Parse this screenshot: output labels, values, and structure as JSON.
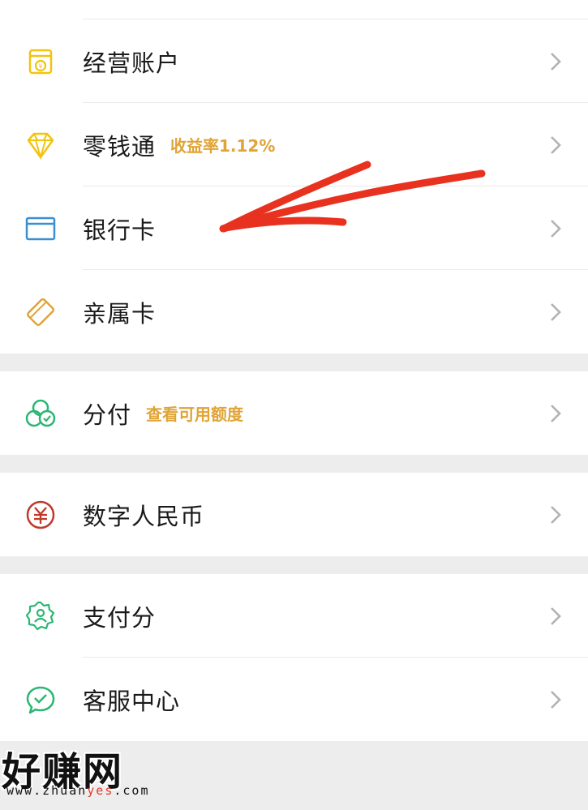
{
  "menu": {
    "group1": [
      {
        "label": "经营账户",
        "icon": "shop-account-icon",
        "color": "#f1c40f"
      },
      {
        "label": "零钱通",
        "tag": "收益率1.12%",
        "icon": "diamond-icon",
        "color": "#f1c40f"
      },
      {
        "label": "银行卡",
        "icon": "bank-card-icon",
        "color": "#3a8fd0"
      },
      {
        "label": "亲属卡",
        "icon": "family-card-icon",
        "color": "#e0a437"
      }
    ],
    "group2": [
      {
        "label": "分付",
        "tag": "查看可用额度",
        "icon": "fenfu-icon",
        "color": "#2bb673"
      }
    ],
    "group3": [
      {
        "label": "数字人民币",
        "icon": "digital-rmb-icon",
        "color": "#c0392b"
      }
    ],
    "group4": [
      {
        "label": "支付分",
        "icon": "pay-score-icon",
        "color": "#2bb673"
      },
      {
        "label": "客服中心",
        "icon": "customer-service-icon",
        "color": "#2bb673"
      }
    ]
  },
  "annotation": {
    "type": "red-arrow",
    "color": "#e8321f",
    "target": "银行卡"
  },
  "watermark": {
    "title": "好赚网",
    "url_prefix": "www.zhuan",
    "url_highlight": "yes",
    "url_suffix": ".com"
  }
}
